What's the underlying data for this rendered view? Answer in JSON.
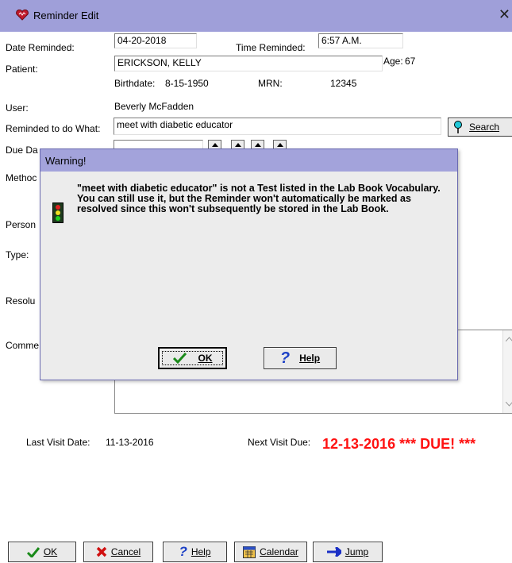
{
  "window": {
    "title": "Reminder Edit",
    "close": "✕"
  },
  "form": {
    "date_reminded_label": "Date Reminded:",
    "date_reminded": "04-20-2018",
    "time_reminded_label": "Time Reminded:",
    "time_reminded": "6:57 A.M.",
    "patient_label": "Patient:",
    "patient": "ERICKSON, KELLY",
    "age_label": "Age:",
    "age": "67",
    "birthdate_label": "Birthdate:",
    "birthdate": "8-15-1950",
    "mrn_label": "MRN:",
    "mrn": "12345",
    "user_label": "User:",
    "user": "Beverly McFadden",
    "reminded_label": "Reminded to do What:",
    "reminded_value": "meet with diabetic educator",
    "search_label": "Search",
    "due_label": "Due Da",
    "method_label": "Methoc",
    "person_label": "Person",
    "type_label": "Type:",
    "resolu_label": "Resolu",
    "comme_label": "Comme",
    "last_visit_label": "Last Visit Date:",
    "last_visit": "11-13-2016",
    "next_visit_label": "Next Visit Due:",
    "next_visit": "12-13-2016 *** DUE! ***"
  },
  "dialog": {
    "title": "Warning!",
    "message": "\"meet with diabetic educator\" is not a Test listed in the Lab Book Vocabulary.\nYou can still use it, but the Reminder won't automatically be marked as resolved since this won't subsequently be stored in the Lab Book.",
    "ok": "OK",
    "help": "Help"
  },
  "buttons": {
    "ok": "OK",
    "cancel": "Cancel",
    "help": "Help",
    "calendar": "Calendar",
    "jump": "Jump"
  },
  "colors": {
    "titlebar": "#9f9fd9",
    "dialog_titlebar": "#a3a3db",
    "due_red": "#ff1111"
  }
}
